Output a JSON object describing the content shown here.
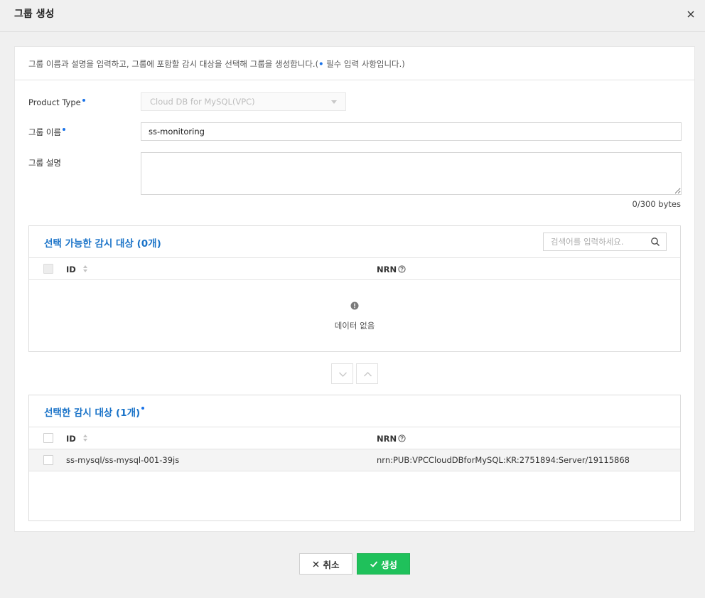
{
  "dialog": {
    "title": "그룹 생성",
    "close_icon": "close-icon"
  },
  "intro": {
    "text_before": "그룹 이름과 설명을 입력하고, 그룹에 포함할 감시 대상을 선택해 그룹을 생성합니다.(",
    "dot": "•",
    "text_after": " 필수 입력 사항입니다.)"
  },
  "form": {
    "product_type_label": "Product Type",
    "product_type_value": "Cloud DB for MySQL(VPC)",
    "group_name_label": "그룹 이름",
    "group_name_value": "ss-monitoring",
    "group_desc_label": "그룹 설명",
    "group_desc_value": "",
    "byte_counter": "0/300 bytes"
  },
  "available": {
    "title": "선택 가능한 감시 대상 (0개)",
    "search_placeholder": "검색어를 입력하세요.",
    "col_id": "ID",
    "col_nrn": "NRN",
    "empty_text": "데이터 없음"
  },
  "selected": {
    "title": "선택한 감시 대상 (1개)",
    "col_id": "ID",
    "col_nrn": "NRN",
    "rows": [
      {
        "id": "ss-mysql/ss-mysql-001-39js",
        "nrn": "nrn:PUB:VPCCloudDBforMySQL:KR:2751894:Server/19115868"
      }
    ]
  },
  "footer": {
    "cancel_label": "취소",
    "create_label": "생성"
  },
  "colors": {
    "accent": "#1a73c8",
    "primary_button": "#1fc15b",
    "required_dot": "#1a73e8"
  }
}
